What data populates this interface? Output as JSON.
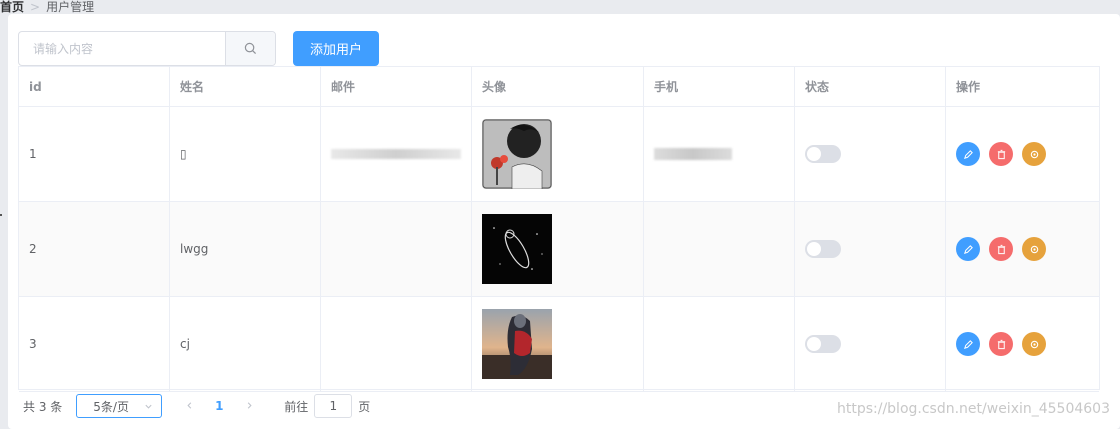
{
  "breadcrumb": {
    "home": "首页",
    "separator": ">",
    "current": "用户管理"
  },
  "search": {
    "placeholder": "请输入内容",
    "value": ""
  },
  "toolbar": {
    "add_label": "添加用户"
  },
  "table": {
    "columns": [
      "id",
      "姓名",
      "邮件",
      "头像",
      "手机",
      "状态",
      "操作"
    ],
    "rows": [
      {
        "id": "1",
        "name": "▯",
        "email_blurred": true,
        "phone_blurred": true,
        "status": false,
        "avatar": "anime-red-flower"
      },
      {
        "id": "2",
        "name": "lwgg",
        "email_blurred": false,
        "phone_blurred": false,
        "status": false,
        "avatar": "astronaut-dark"
      },
      {
        "id": "3",
        "name": "cj",
        "email_blurred": false,
        "phone_blurred": false,
        "status": false,
        "avatar": "ultraman-sunset"
      }
    ]
  },
  "actions": {
    "edit_icon": "edit-icon",
    "delete_icon": "delete-icon",
    "settings_icon": "settings-icon"
  },
  "pagination": {
    "total_label": "共 3 条",
    "page_size": "5条/页",
    "current_page": "1",
    "goto_label": "前往",
    "goto_value": "1",
    "page_suffix": "页"
  },
  "watermark": "https://blog.csdn.net/weixin_45504603",
  "colors": {
    "primary": "#409eff",
    "danger": "#f56c6c",
    "warning": "#e6a23c",
    "border": "#ebeef5"
  }
}
